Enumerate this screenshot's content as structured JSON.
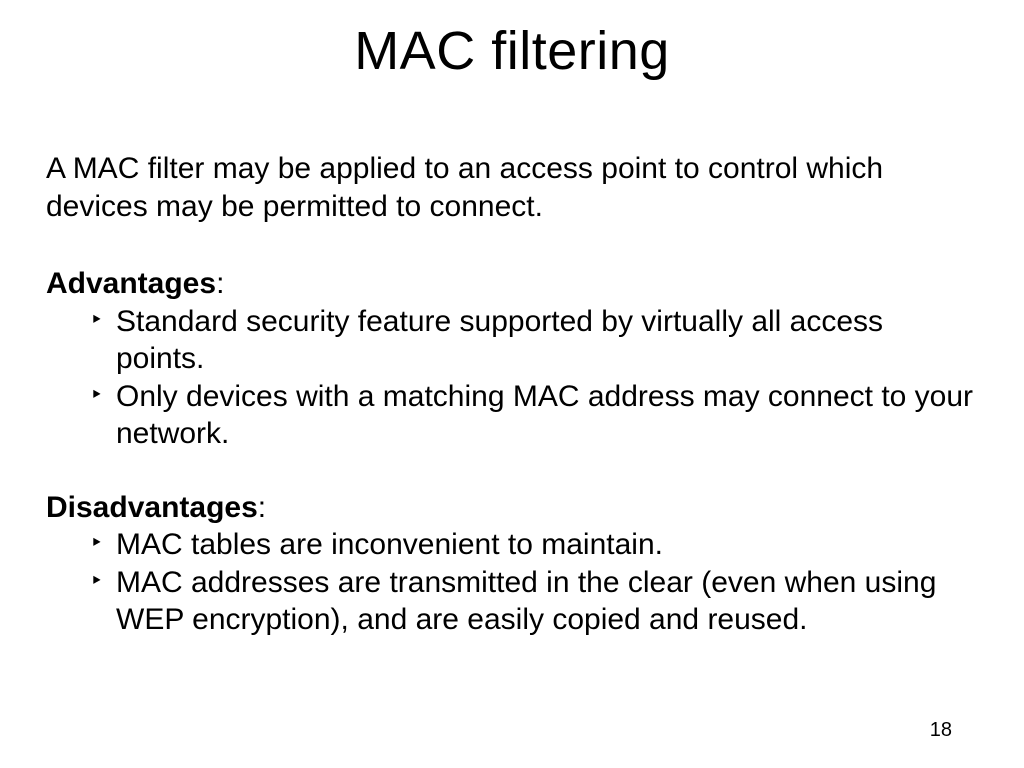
{
  "title": "MAC filtering",
  "intro": "A MAC filter may be applied to an access point to control which devices may be permitted to connect.",
  "advantages": {
    "heading": "Advantages",
    "items": [
      "Standard security feature supported by virtually all access points.",
      "Only devices with a matching MAC address may connect to your network."
    ]
  },
  "disadvantages": {
    "heading": "Disadvantages",
    "items": [
      "MAC tables are inconvenient to maintain.",
      "MAC addresses are transmitted in the clear (even when using WEP encryption), and are easily copied and reused."
    ]
  },
  "page_number": "18",
  "bullet_glyph": "‣"
}
